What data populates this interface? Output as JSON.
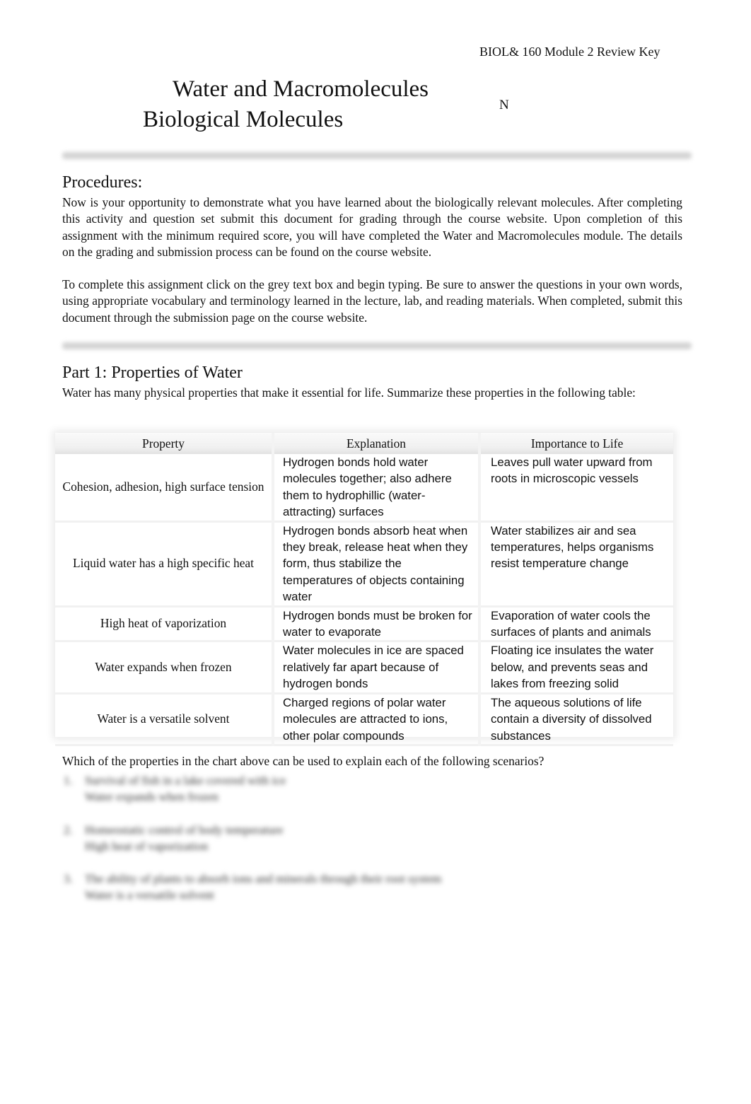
{
  "header": {
    "course_key": "BIOL& 160 Module 2 Review Key",
    "title_line1": "Water and Macromolecules",
    "title_line2": "Biological Molecules",
    "marker": "N"
  },
  "procedures": {
    "heading": "Procedures:",
    "paragraph1": "Now is your opportunity to demonstrate what you have learned about the biologically relevant molecules. After completing this activity and question set submit this document for grading through the course website. Upon completion of this assignment with the minimum required score, you will have completed the Water and Macromolecules module. The details on the grading and submission process can be found on the course website.",
    "paragraph2": "To complete this assignment click on the grey text box and begin typing. Be sure to answer the questions in your own words, using appropriate vocabulary and terminology learned in the lecture, lab, and reading materials. When completed, submit this document through the submission page on the course website."
  },
  "part1": {
    "heading": "Part 1: Properties of Water",
    "intro": "Water has many physical properties that make it essential for life. Summarize these properties in the following table:",
    "table": {
      "headers": [
        "Property",
        "Explanation",
        "Importance to Life"
      ],
      "rows": [
        {
          "property": "Cohesion, adhesion, high surface tension",
          "explanation": "Hydrogen bonds hold water molecules together; also adhere them to hydrophillic (water-attracting) surfaces",
          "importance": "Leaves pull water upward from roots in microscopic vessels"
        },
        {
          "property": "Liquid water has a high specific heat",
          "explanation": "Hydrogen bonds absorb heat when they break, release heat when they form, thus stabilize the temperatures of objects containing water",
          "importance": "Water stabilizes air and sea temperatures, helps organisms resist temperature change"
        },
        {
          "property": "High heat of vaporization",
          "explanation": "Hydrogen bonds must be broken for water to evaporate",
          "importance": "Evaporation of water cools the surfaces of plants and animals"
        },
        {
          "property": "Water expands when frozen",
          "explanation": "Water molecules in ice are spaced relatively far apart because of hydrogen bonds",
          "importance": "Floating ice insulates the water below, and prevents seas and lakes from freezing solid"
        },
        {
          "property": "Water is a versatile solvent",
          "explanation": "Charged regions of polar water molecules are attracted to ions, other polar compounds",
          "importance": "The aqueous solutions of life contain a diversity of dissolved substances"
        }
      ]
    },
    "question_intro": "Which of the properties in the chart above can be used to explain each of the following scenarios?",
    "scenarios": [
      {
        "number": "1.",
        "scenario": "Survival of fish in a lake covered with ice",
        "answer": "Water expands when frozen"
      },
      {
        "number": "2.",
        "scenario": "Homeostatic control of body temperature",
        "answer": "High heat of vaporization"
      },
      {
        "number": "3.",
        "scenario": "The ability of plants to absorb ions and minerals through their root system",
        "answer": "Water is a versatile solvent"
      }
    ]
  }
}
